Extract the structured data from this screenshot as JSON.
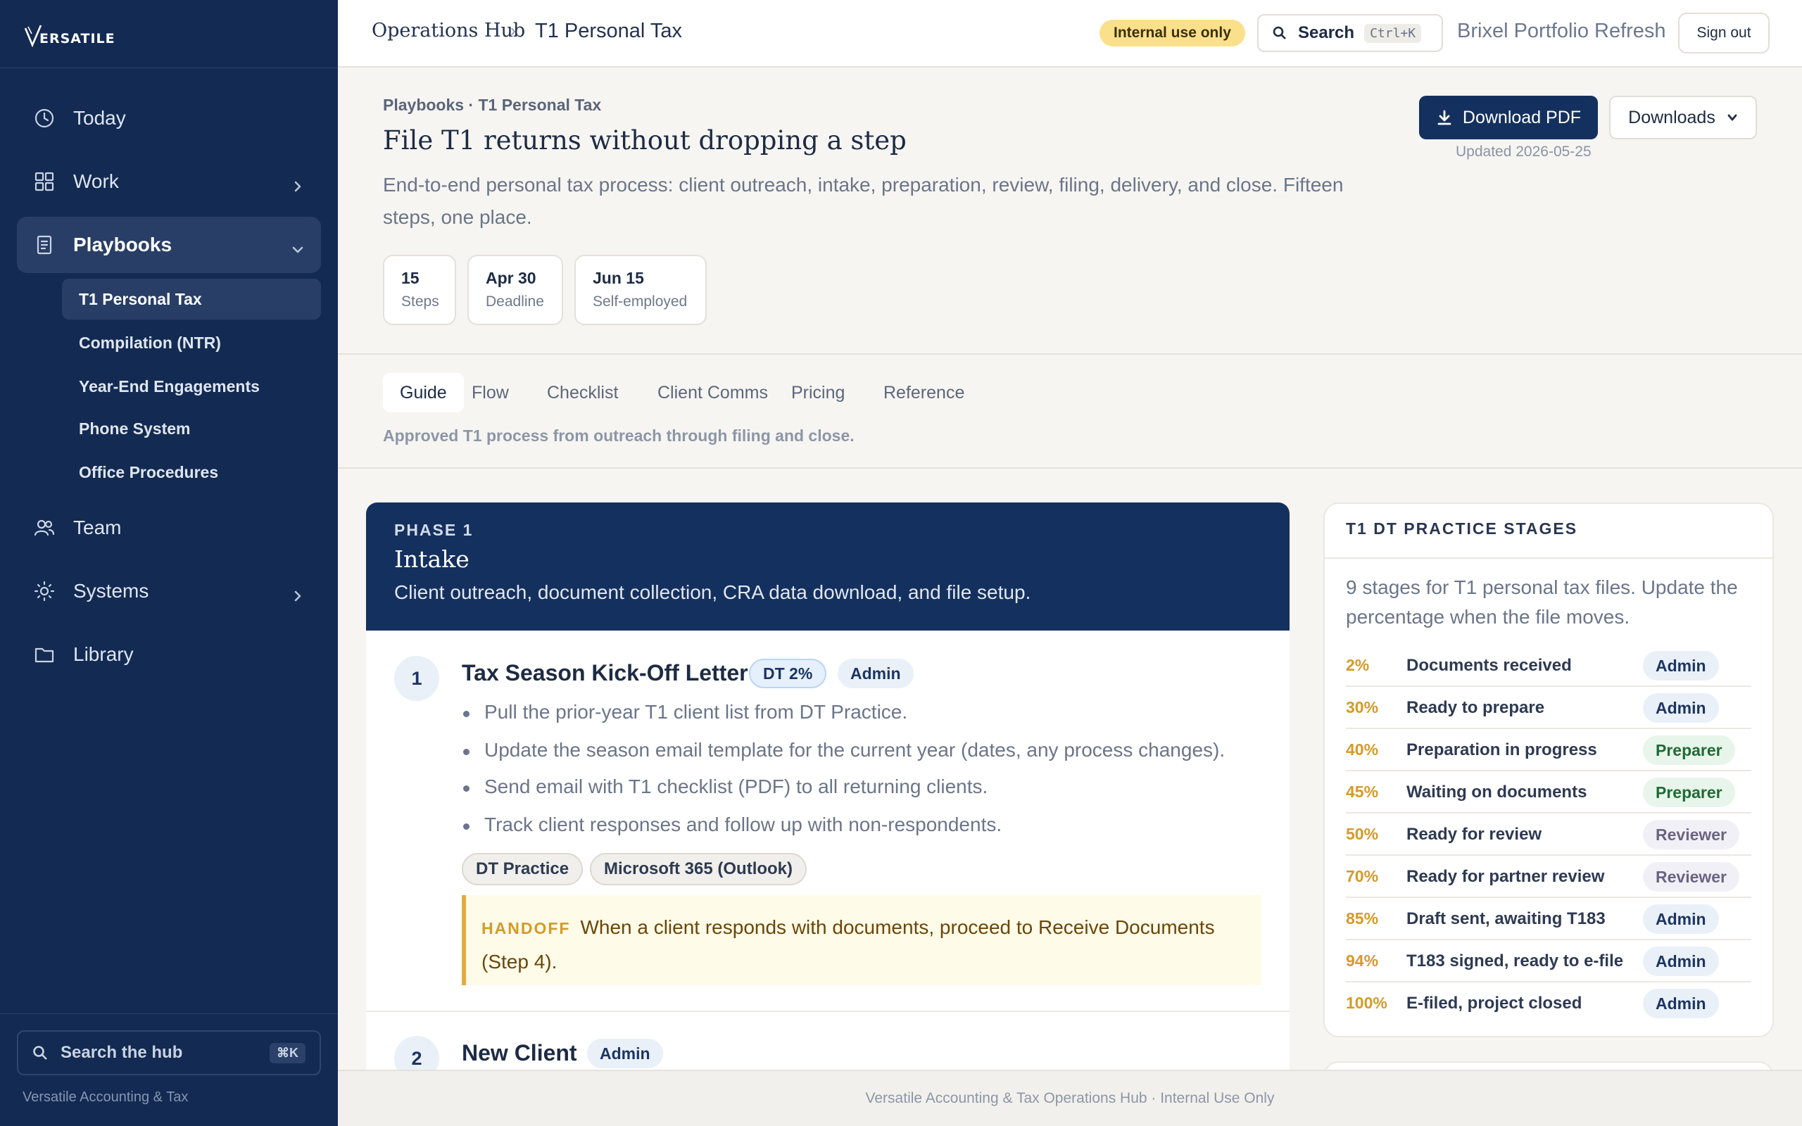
{
  "brand": {
    "logo_text": "ERSATILE"
  },
  "sidebar": {
    "nav": [
      {
        "label": "Today",
        "icon": "clock-icon"
      },
      {
        "label": "Work",
        "icon": "grid-icon"
      },
      {
        "label": "Playbooks",
        "icon": "document-icon"
      },
      {
        "label": "Team",
        "icon": "users-icon"
      },
      {
        "label": "Systems",
        "icon": "sun-icon"
      },
      {
        "label": "Library",
        "icon": "folder-icon"
      }
    ],
    "playbooks_sub": [
      "T1 Personal Tax",
      "Compilation (NTR)",
      "Year-End Engagements",
      "Phone System",
      "Office Procedures"
    ],
    "search_label": "Search the hub",
    "search_kbd": "⌘K",
    "footer": "Versatile Accounting & Tax"
  },
  "topbar": {
    "crumb_root": "Operations Hub",
    "crumb_sep": "›",
    "crumb_current": "T1 Personal Tax",
    "internal_badge": "Internal use only",
    "search_label": "Search",
    "search_kbd": "Ctrl+K",
    "project": "Brixel Portfolio Refresh",
    "signout": "Sign out"
  },
  "header": {
    "crumbs": "Playbooks · T1 Personal Tax",
    "title": "File T1 returns without dropping a step",
    "description": "End-to-end personal tax process: client outreach, intake, preparation, review, filing, delivery, and close. Fifteen steps, one place.",
    "stats": [
      {
        "value": "15",
        "label": "Steps"
      },
      {
        "value": "Apr 30",
        "label": "Deadline"
      },
      {
        "value": "Jun 15",
        "label": "Self-employed"
      }
    ],
    "download_pdf": "Download PDF",
    "downloads": "Downloads",
    "updated": "Updated 2026-05-25"
  },
  "tabs": {
    "items": [
      "Guide",
      "Flow",
      "Checklist",
      "Client Comms",
      "Pricing",
      "Reference"
    ],
    "active": "Guide",
    "caption": "Approved T1 process from outreach through filing and close."
  },
  "phase": {
    "label": "PHASE 1",
    "title": "Intake",
    "description": "Client outreach, document collection, CRA data download, and file setup.",
    "steps": [
      {
        "number": "1",
        "title": "Tax Season Kick-Off Letter",
        "badges": [
          "DT 2%",
          "Admin"
        ],
        "bullets": [
          "Pull the prior-year T1 client list from DT Practice.",
          "Update the season email template for the current year (dates, any process changes).",
          "Send email with T1 checklist (PDF) to all returning clients.",
          "Track client responses and follow up with non-respondents."
        ],
        "tools": [
          "DT Practice",
          "Microsoft 365 (Outlook)"
        ],
        "handoff_tag": "HANDOFF",
        "handoff_text": "When a client responds with documents, proceed to Receive Documents (Step 4)."
      },
      {
        "number": "2",
        "title": "New Client",
        "badges": [
          "Admin"
        ]
      }
    ]
  },
  "stages": {
    "title": "T1 DT PRACTICE STAGES",
    "description": "9 stages for T1 personal tax files. Update the percentage when the file moves.",
    "rows": [
      {
        "pct": "2%",
        "name": "Documents received",
        "role": "Admin"
      },
      {
        "pct": "30%",
        "name": "Ready to prepare",
        "role": "Admin"
      },
      {
        "pct": "40%",
        "name": "Preparation in progress",
        "role": "Preparer"
      },
      {
        "pct": "45%",
        "name": "Waiting on documents",
        "role": "Preparer"
      },
      {
        "pct": "50%",
        "name": "Ready for review",
        "role": "Reviewer"
      },
      {
        "pct": "70%",
        "name": "Ready for partner review",
        "role": "Reviewer"
      },
      {
        "pct": "85%",
        "name": "Draft sent, awaiting T183",
        "role": "Admin"
      },
      {
        "pct": "94%",
        "name": "T183 signed, ready to e-file",
        "role": "Admin"
      },
      {
        "pct": "100%",
        "name": "E-filed, project closed",
        "role": "Admin"
      }
    ]
  },
  "footer": "Versatile Accounting & Tax Operations Hub · Internal Use Only"
}
